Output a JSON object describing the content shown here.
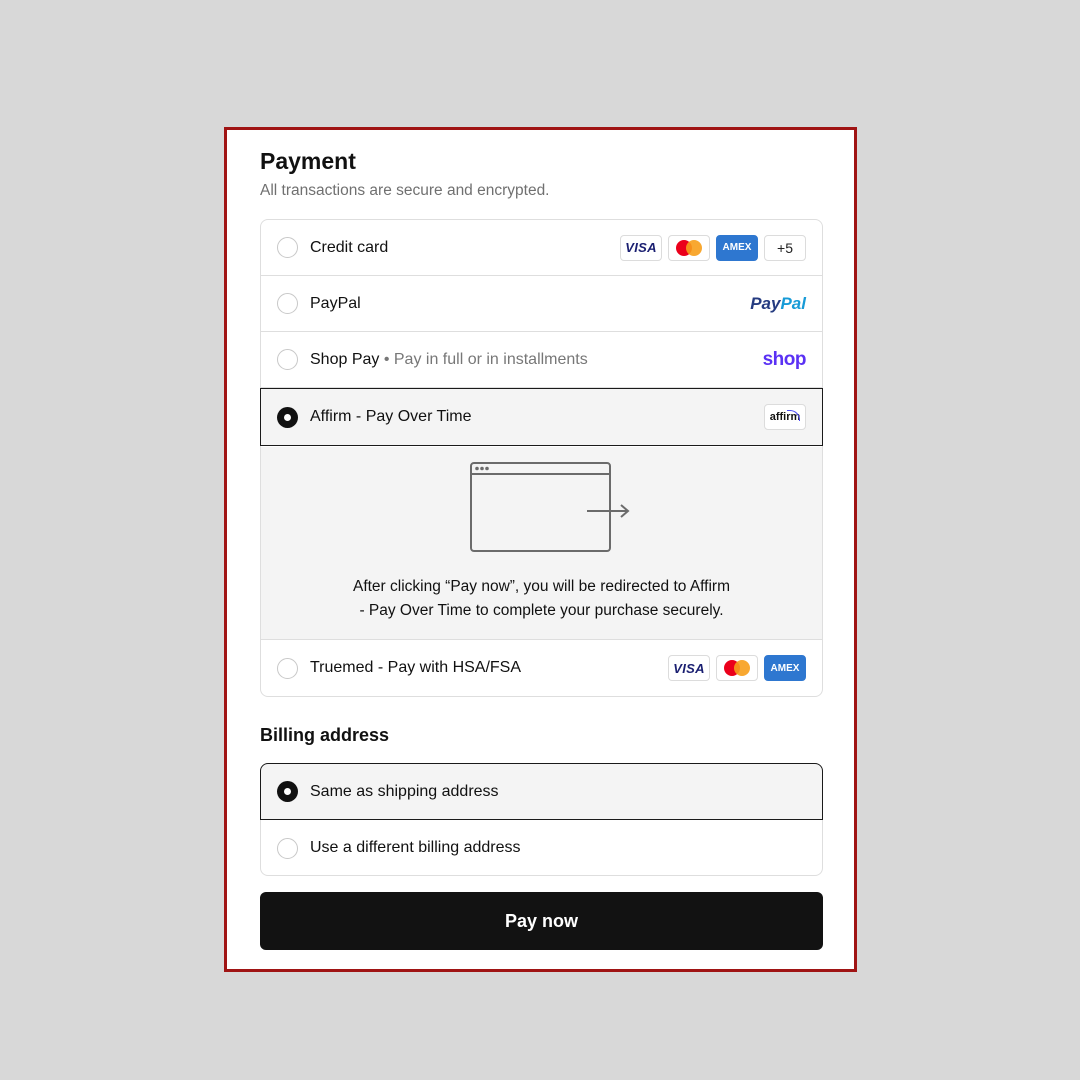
{
  "payment": {
    "title": "Payment",
    "subtitle": "All transactions are secure and encrypted.",
    "methods": [
      {
        "label": "Credit card",
        "selected": false,
        "badges": [
          "VISA",
          "Mastercard",
          "AMEX",
          "+5"
        ]
      },
      {
        "label": "PayPal",
        "selected": false,
        "logo_text_1": "Pay",
        "logo_text_2": "Pal"
      },
      {
        "label": "Shop Pay",
        "extra": " • Pay in full or in installments",
        "selected": false,
        "logo_text": "shop"
      },
      {
        "label": "Affirm - Pay Over Time",
        "selected": true,
        "logo_text": "affirm"
      },
      {
        "label": "Truemed - Pay with HSA/FSA",
        "selected": false,
        "badges": [
          "VISA",
          "Mastercard",
          "AMEX"
        ]
      }
    ],
    "redirect_message_line1": "After clicking “Pay now”, you will be redirected to Affirm",
    "redirect_message_line2": "- Pay Over Time to complete your purchase securely."
  },
  "billing": {
    "title": "Billing address",
    "options": [
      {
        "label": "Same as shipping address",
        "selected": true
      },
      {
        "label": "Use a different billing address",
        "selected": false
      }
    ]
  },
  "pay_button_label": "Pay now",
  "colors": {
    "frame_border": "#a01414",
    "button_bg": "#121212",
    "selected_bg": "#f4f4f4",
    "paypal_dark": "#253b80",
    "paypal_light": "#179bd7",
    "shop_purple": "#5a31f4",
    "amex_blue": "#2e77d0"
  },
  "icons": [
    "visa-card-icon",
    "mastercard-icon",
    "amex-card-icon",
    "paypal-logo",
    "shop-pay-logo",
    "affirm-logo",
    "browser-redirect-icon"
  ]
}
